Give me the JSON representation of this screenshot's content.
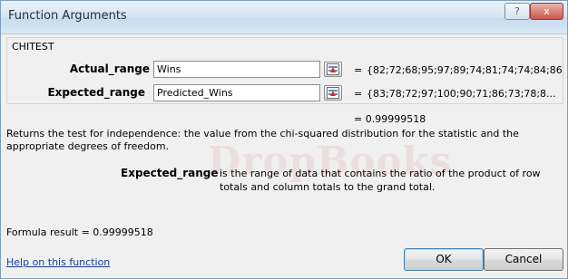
{
  "window": {
    "title": "Function Arguments",
    "help_glyph": "?",
    "close_glyph": "x"
  },
  "function_name": "CHITEST",
  "arguments": [
    {
      "label": "Actual_range",
      "input": "Wins",
      "equals": "=",
      "value": "{82;72;68;95;97;89;74;81;74;74;84;86"
    },
    {
      "label": "Expected_range",
      "input": "Predicted_Wins",
      "equals": "=",
      "value": "{83;78;72;97;100;90;71;86;73;78;8..."
    }
  ],
  "result_value": "= 0.99999518",
  "description": "Returns the test for independence: the value from the chi-squared distribution for the statistic and the appropriate degrees of freedom.",
  "argument_help": {
    "name": "Expected_range",
    "text": "is the range of data that contains the ratio of the product of row totals and column totals to the grand total."
  },
  "formula_result": "Formula result =  0.99999518",
  "help_link": "Help on this function",
  "buttons": {
    "ok": "OK",
    "cancel": "Cancel"
  },
  "watermark": "DropBooks"
}
